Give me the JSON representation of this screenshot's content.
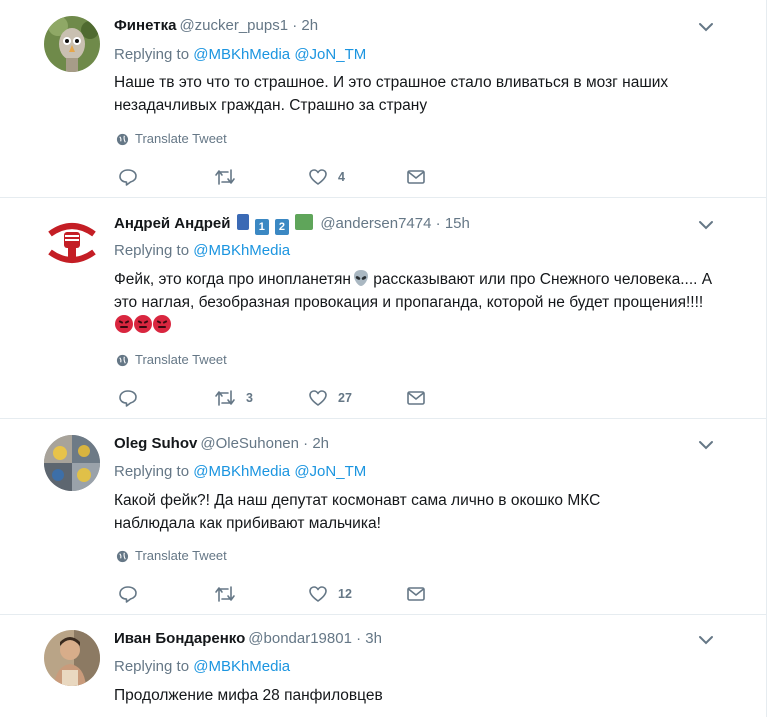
{
  "translate_label": "Translate Tweet",
  "replying_prefix": "Replying to",
  "colors": {
    "link": "#1b95e0",
    "secondary": "#657786",
    "divider": "#e6ecf0"
  },
  "tweets": [
    {
      "name": "Финетка",
      "handle": "@zucker_pups1",
      "time": "2h",
      "replying_to": [
        "@MBKhMedia",
        "@JoN_TM"
      ],
      "text": "Наше тв это что то страшное. И это страшное стало вливаться в мозг наших незадачливых граждан. Страшно за страну",
      "replies": "",
      "retweets": "",
      "likes": "4"
    },
    {
      "name": "Андрей Андрей",
      "handle": "@andersen7474",
      "time": "15h",
      "badges": [
        "1",
        "2"
      ],
      "replying_to": [
        "@MBKhMedia"
      ],
      "text_parts": [
        "Фейк, это когда про инопланетян",
        " рассказывают или про Снежного человека.... А это наглая, безобразная провокация и пропаганда, которой не будет прощения!!!!"
      ],
      "icons": [
        "alien-emoji",
        "angry-face-emoji"
      ],
      "replies": "",
      "retweets": "3",
      "likes": "27"
    },
    {
      "name": "Oleg Suhov",
      "handle": "@OleSuhonen",
      "time": "2h",
      "replying_to": [
        "@MBKhMedia",
        "@JoN_TM"
      ],
      "text": "Какой фейк?! Да наш депутат космонавт сама лично в окошко МКС наблюдала как прибивают мальчика!",
      "replies": "",
      "retweets": "",
      "likes": "12"
    },
    {
      "name": "Иван Бондаренко",
      "handle": "@bondar19801",
      "time": "3h",
      "replying_to": [
        "@MBKhMedia"
      ],
      "text": "Продолжение мифа 28 панфиловцев"
    }
  ]
}
